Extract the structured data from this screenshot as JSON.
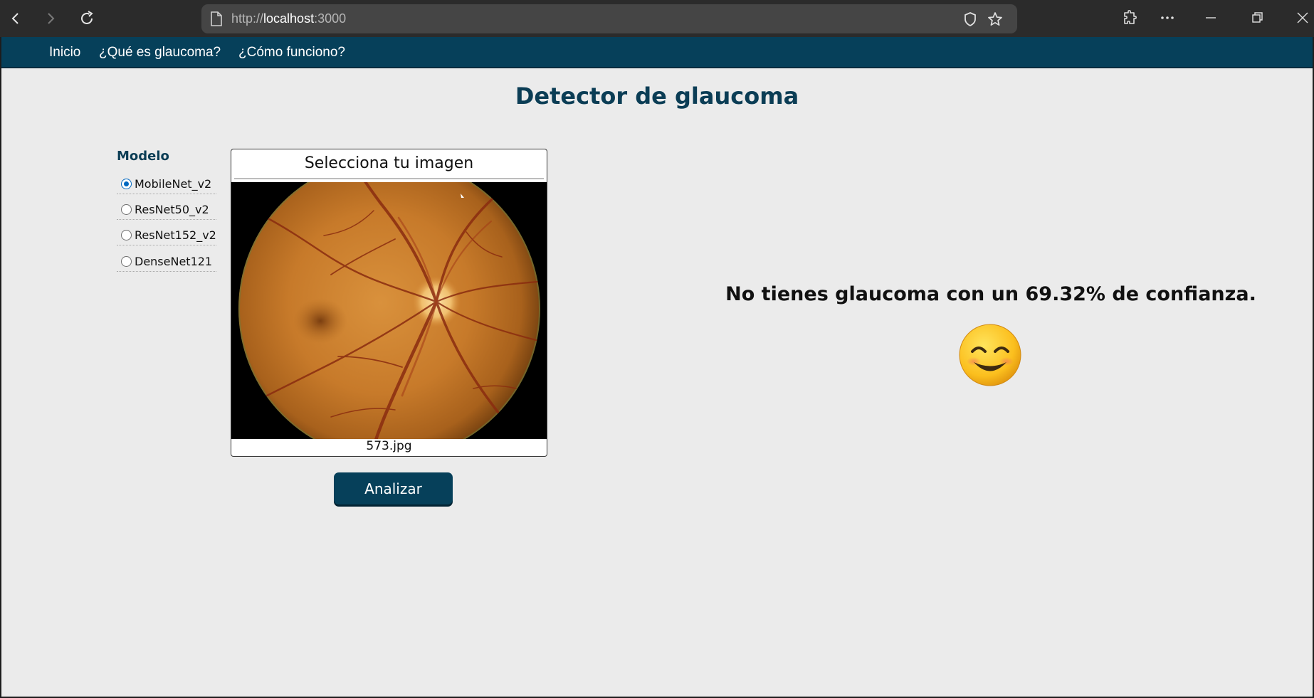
{
  "browser": {
    "back_icon": "chevron-left-icon",
    "forward_icon": "chevron-right-icon",
    "reload_icon": "reload-icon",
    "url_prefix": "http://",
    "url_host": "localhost",
    "url_port": ":3000",
    "right_icons": [
      "shield-icon",
      "star-icon",
      "extensions-icon",
      "more-icon"
    ],
    "window_controls": [
      "minimize-icon",
      "restore-icon",
      "close-icon"
    ]
  },
  "nav": {
    "items": [
      {
        "label": "Inicio"
      },
      {
        "label": "¿Qué es glaucoma?"
      },
      {
        "label": "¿Cómo funciono?"
      }
    ]
  },
  "page": {
    "title": "Detector de glaucoma"
  },
  "model": {
    "label": "Modelo",
    "options": [
      {
        "label": "MobileNet_v2",
        "checked": true
      },
      {
        "label": "ResNet50_v2",
        "checked": false
      },
      {
        "label": "ResNet152_v2",
        "checked": false
      },
      {
        "label": "DenseNet121",
        "checked": false
      }
    ]
  },
  "upload": {
    "header": "Selecciona tu imagen",
    "filename": "573.jpg",
    "image_icon": "retina-fundus-image"
  },
  "analyze_label": "Analizar",
  "result": {
    "text": "No tienes glaucoma con un 69.32% de confianza.",
    "emoji_icon": "smiling-face-icon"
  },
  "colors": {
    "nav_bg": "#06405a",
    "title": "#0b3d55",
    "page_bg": "#ebebeb",
    "radio_accent": "#0067c0"
  }
}
